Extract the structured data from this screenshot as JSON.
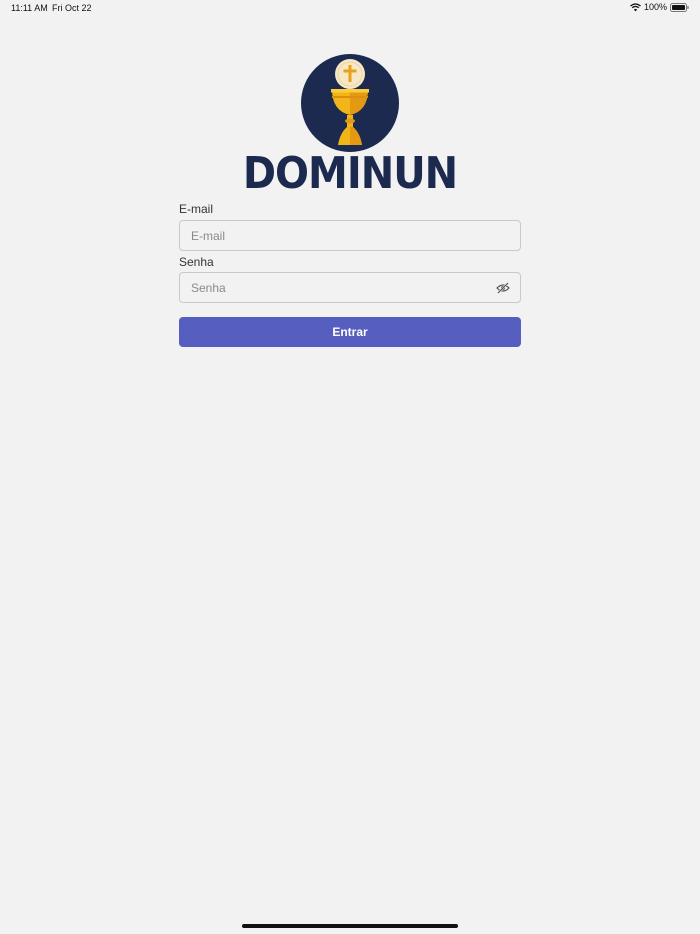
{
  "status_bar": {
    "time": "11:11 AM",
    "date": "Fri Oct 22",
    "battery": "100%",
    "icons": [
      "wifi-icon",
      "battery-icon"
    ]
  },
  "brand": {
    "name": "DOMINUN",
    "logo_icon": "chalice-host-icon",
    "colors": {
      "navy": "#1b2a4e",
      "gold": "#f2b519",
      "host": "#f6e7c6"
    }
  },
  "form": {
    "email": {
      "label": "E-mail",
      "placeholder": "E-mail",
      "value": ""
    },
    "password": {
      "label": "Senha",
      "placeholder": "Senha",
      "value": "",
      "toggle_icon": "eye-off-icon"
    },
    "submit_label": "Entrar",
    "button_color": "#565fbf"
  }
}
